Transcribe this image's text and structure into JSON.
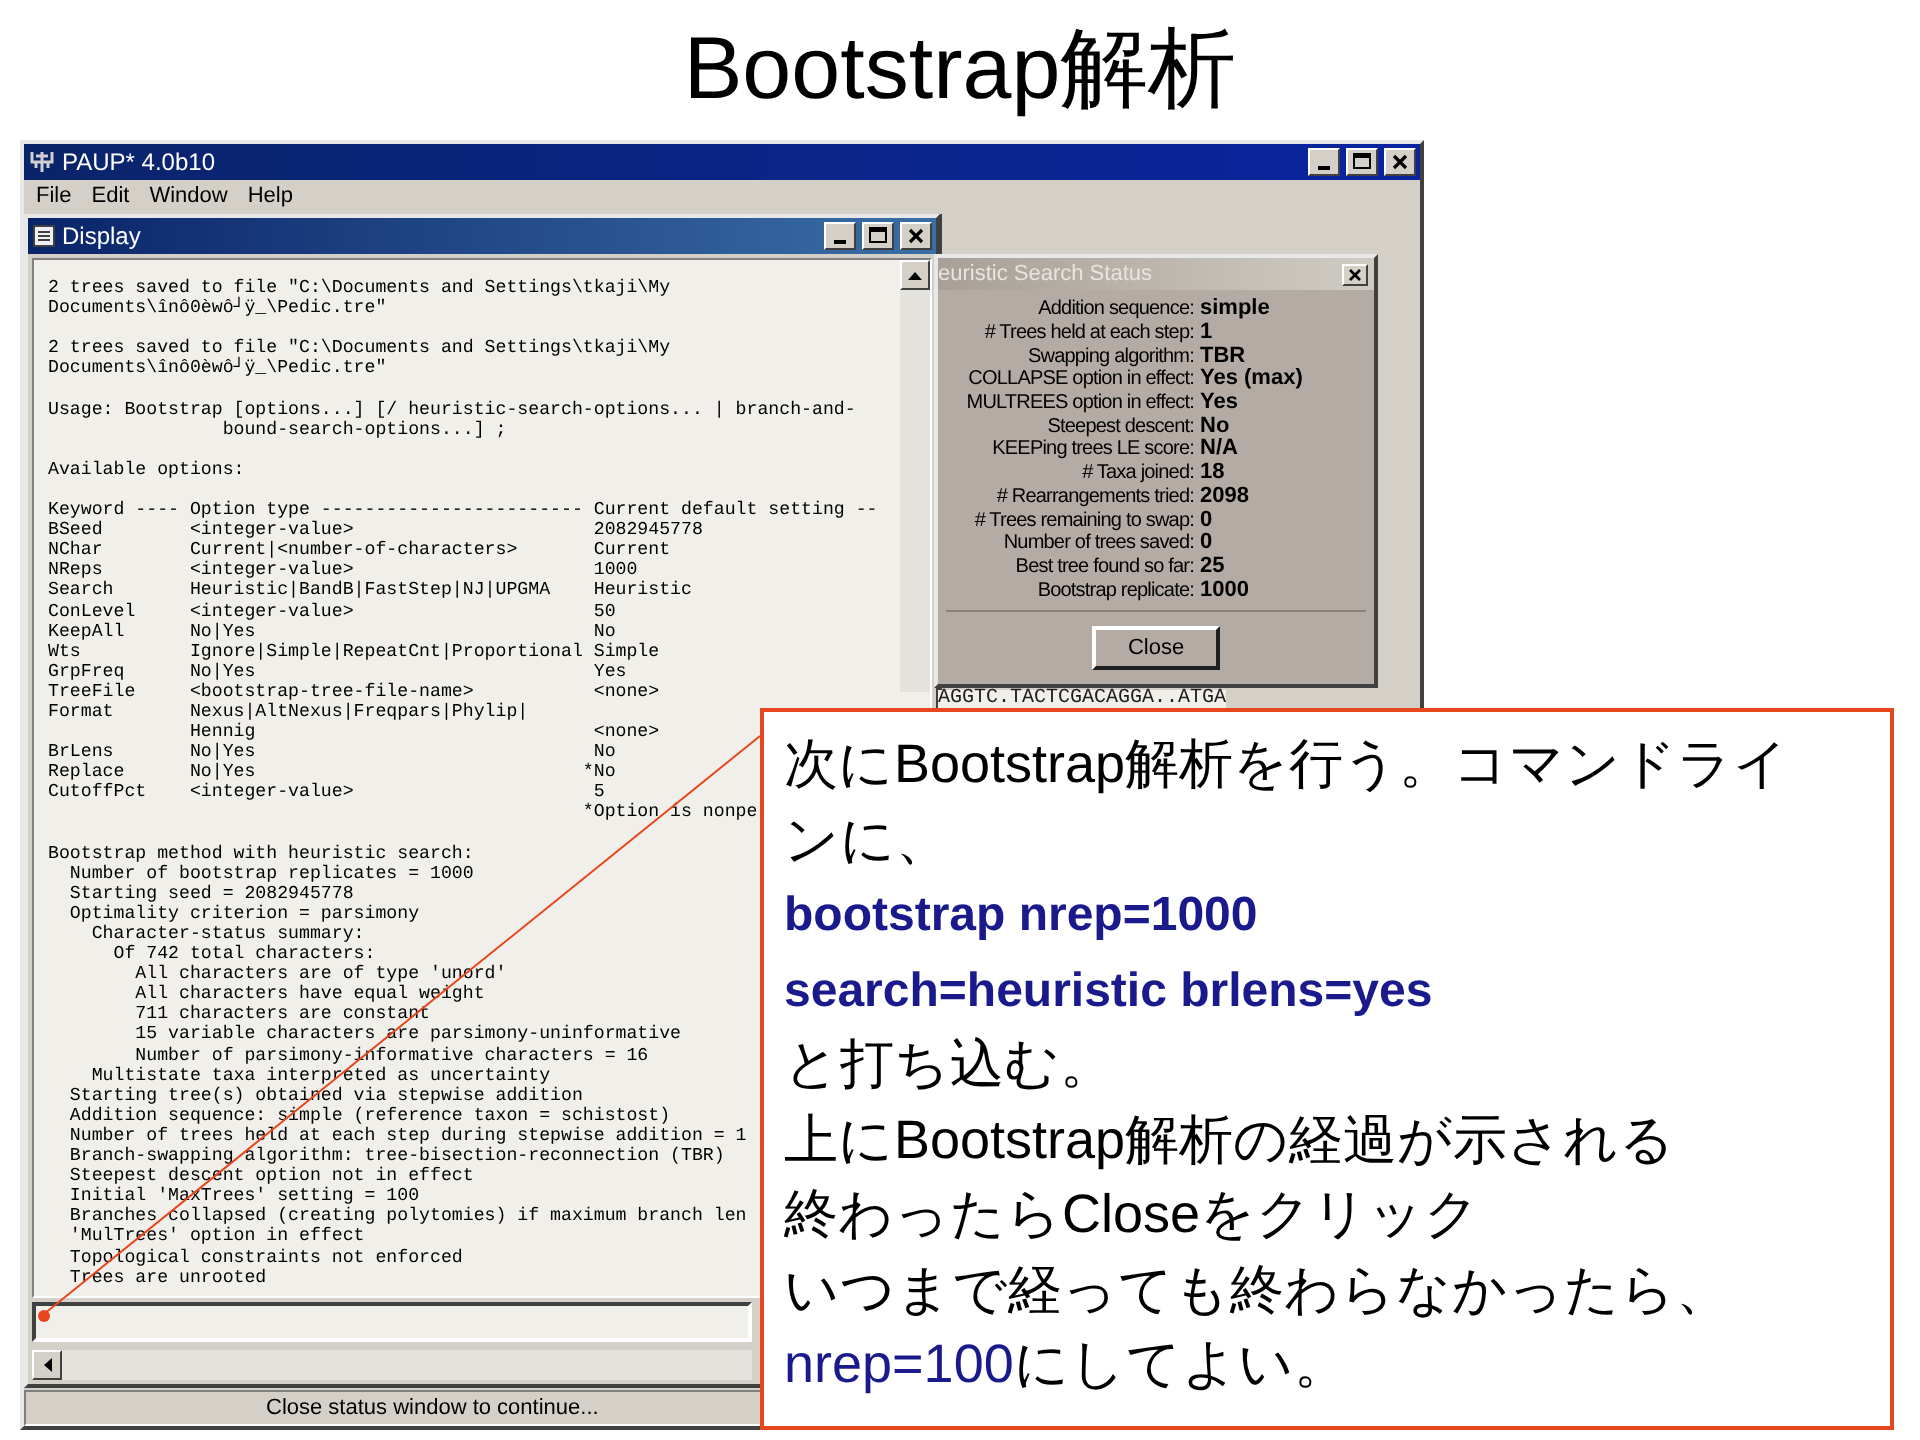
{
  "slide_title": "Bootstrap解析",
  "window": {
    "title": "PAUP* 4.0b10",
    "menu": [
      "File",
      "Edit",
      "Window",
      "Help"
    ],
    "status_bar": "Close status window to continue..."
  },
  "display": {
    "title": "Display",
    "blocks": [
      [
        "2 trees saved to file \"C:\\Documents and Settings\\tkaji\\My",
        "Documents\\înô0èwô┘ÿ_\\Pedic.tre\""
      ],
      [
        "2 trees saved to file \"C:\\Documents and Settings\\tkaji\\My",
        "Documents\\înô0èwô┘ÿ_\\Pedic.tre\""
      ],
      [
        "Usage: Bootstrap [options...] [/ heuristic-search-options... | branch-and-",
        "                bound-search-options...] ;"
      ],
      [
        "Available options:"
      ],
      [
        "Keyword ---- Option type ------------------------ Current default setting --",
        "BSeed        <integer-value>                      2082945778",
        "NChar        Current|<number-of-characters>       Current",
        "NReps        <integer-value>                      1000",
        "Search       Heuristic|BandB|FastStep|NJ|UPGMA    Heuristic",
        "ConLevel     <integer-value>                      50",
        "KeepAll      No|Yes                               No",
        "Wts          Ignore|Simple|RepeatCnt|Proportional Simple",
        "GrpFreq      No|Yes                               Yes",
        "TreeFile     <bootstrap-tree-file-name>           <none>",
        "Format       Nexus|AltNexus|Freqpars|Phylip|",
        "             Hennig                               <none>",
        "BrLens       No|Yes                               No",
        "Replace      No|Yes                              *No",
        "CutoffPct    <integer-value>                      5",
        "                                                 *Option is nonpe"
      ],
      [
        "Bootstrap method with heuristic search:",
        "  Number of bootstrap replicates = 1000",
        "  Starting seed = 2082945778",
        "  Optimality criterion = parsimony",
        "    Character-status summary:",
        "      Of 742 total characters:",
        "        All characters are of type 'unord'",
        "        All characters have equal weight",
        "        711 characters are constant",
        "        15 variable characters are parsimony-uninformative",
        "        Number of parsimony-informative characters = 16",
        "    Multistate taxa interpreted as uncertainty",
        "  Starting tree(s) obtained via stepwise addition",
        "  Addition sequence: simple (reference taxon = schistost)",
        "  Number of trees held at each step during stepwise addition = 1",
        "  Branch-swapping algorithm: tree-bisection-reconnection (TBR)",
        "  Steepest descent option not in effect",
        "  Initial 'MaxTrees' setting = 100",
        "  Branches collapsed (creating polytomies) if maximum branch len",
        "  'MulTrees' option in effect",
        "  Topological constraints not enforced",
        "  Trees are unrooted"
      ]
    ]
  },
  "status_dialog": {
    "title": "euristic Search Status",
    "rows": [
      {
        "label": "Addition sequence:",
        "value": "simple"
      },
      {
        "label": "# Trees held at each step:",
        "value": "1"
      },
      {
        "label": "Swapping algorithm:",
        "value": "TBR"
      },
      {
        "label": "COLLAPSE option in effect:",
        "value": "Yes (max)"
      },
      {
        "label": "MULTREES option in effect:",
        "value": "Yes"
      },
      {
        "label": "Steepest descent:",
        "value": "No"
      },
      {
        "label": "KEEPing trees LE score:",
        "value": "N/A"
      },
      {
        "label": "# Taxa joined:",
        "value": "18"
      },
      {
        "label": "# Rearrangements tried:",
        "value": "2098"
      },
      {
        "label": "# Trees remaining to swap:",
        "value": "0"
      },
      {
        "label": "Number of trees saved:",
        "value": "0"
      },
      {
        "label": "Best tree found so far:",
        "value": "25"
      },
      {
        "label": "Bootstrap replicate:",
        "value": "1000"
      }
    ],
    "button": "Close"
  },
  "sequence_line": "AGGTC.TACTCGACAGGA..ATGA",
  "callout": {
    "lines": [
      [
        {
          "kind": "plain",
          "text": "次にBootstrap解析を行う。コマンドライ"
        }
      ],
      [
        {
          "kind": "plain",
          "text": "ンに、"
        }
      ],
      [
        {
          "kind": "command",
          "text": "bootstrap nrep=1000"
        }
      ],
      [
        {
          "kind": "command",
          "text": "search=heuristic brlens=yes"
        }
      ],
      [
        {
          "kind": "plain",
          "text": "と打ち込む。"
        }
      ],
      [
        {
          "kind": "plain",
          "text": "上にBootstrap解析の経過が示される"
        }
      ],
      [
        {
          "kind": "plain",
          "text": "終わったらCloseをクリック"
        }
      ],
      [
        {
          "kind": "plain",
          "text": "いつまで経っても終わらなかったら、"
        }
      ],
      [
        {
          "kind": "value",
          "text": "nrep=100"
        },
        {
          "kind": "plain",
          "text": "にしてよい。"
        }
      ]
    ]
  }
}
